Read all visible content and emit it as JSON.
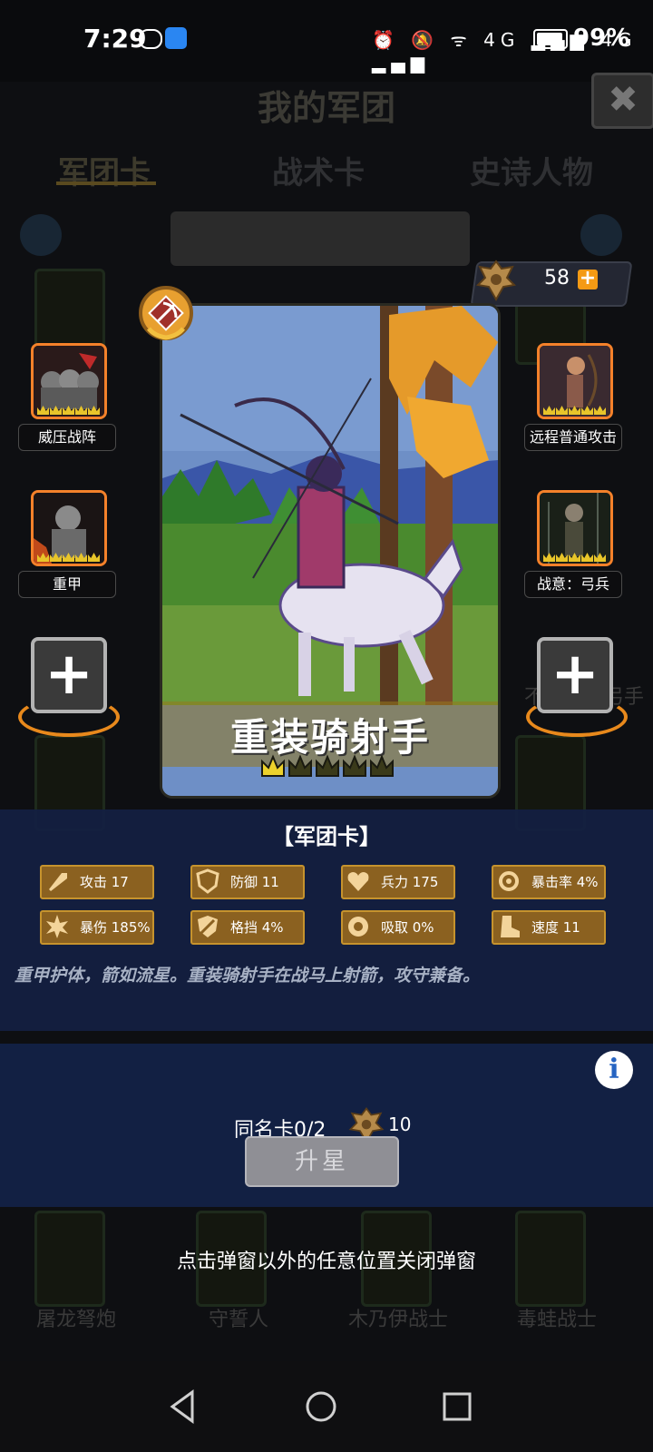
{
  "status_bar": {
    "time": "7:29",
    "signal_icons": "⏰ 🔕 ᯤ 4G ▂▄▆ 4G ▂▄▆",
    "battery": "99%"
  },
  "background": {
    "title": "我的军团",
    "tabs": [
      "军团卡",
      "战术卡",
      "史诗人物"
    ],
    "card_names": [
      "不列颠长弓手",
      "屠龙弩炮",
      "守誓人",
      "木乃伊战士",
      "毒蛙战士"
    ]
  },
  "currency": {
    "count": "58",
    "plus": "+"
  },
  "card": {
    "name": "重装骑射手",
    "stars": 1,
    "max_stars": 5,
    "type_badge_icon": "bow-icon"
  },
  "skills": {
    "left": [
      {
        "label": "威压战阵"
      },
      {
        "label": "重甲"
      }
    ],
    "right": [
      {
        "label": "远程普通攻击"
      },
      {
        "label": "战意：弓兵"
      }
    ],
    "add": "+"
  },
  "info": {
    "title": "【军团卡】",
    "stats": [
      {
        "label": "攻击 17",
        "icon": "sword-icon"
      },
      {
        "label": "防御 11",
        "icon": "shield-icon"
      },
      {
        "label": "兵力 175",
        "icon": "heart-icon"
      },
      {
        "label": "暴击率 4%",
        "icon": "crosshair-icon"
      },
      {
        "label": "暴伤 185%",
        "icon": "burst-icon"
      },
      {
        "label": "格挡 4%",
        "icon": "block-icon"
      },
      {
        "label": "吸取 0%",
        "icon": "drain-icon"
      },
      {
        "label": "速度 11",
        "icon": "boot-icon"
      }
    ],
    "description": "重甲护体，箭如流星。重装骑射手在战马上射箭，攻守兼备。"
  },
  "upgrade": {
    "duplicate_text": "同名卡0/2",
    "cost": "10",
    "button": "升星",
    "info_icon": "i"
  },
  "hint": "点击弹窗以外的任意位置关闭弹窗",
  "colors": {
    "accent_gold": "#c6932d",
    "slot_orange": "#f4812a",
    "panel_blue": "#132042",
    "crown_yellow": "#e8c52a"
  }
}
